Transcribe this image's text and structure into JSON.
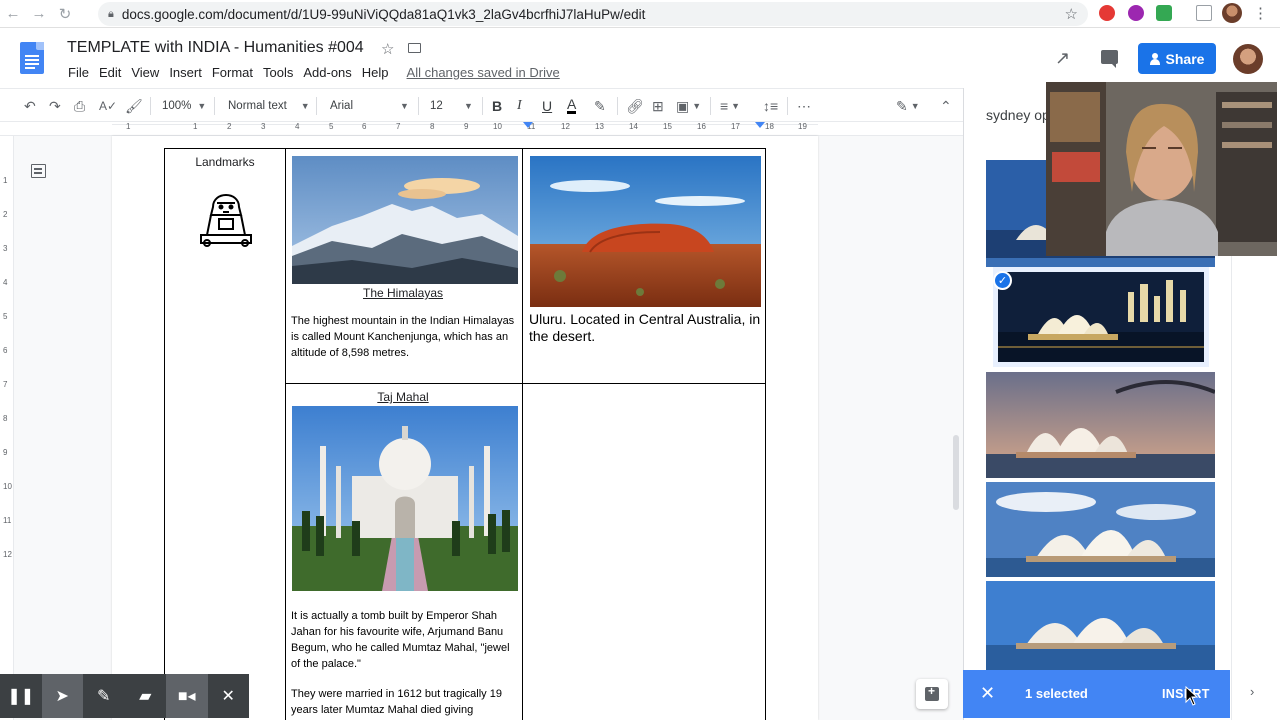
{
  "browser": {
    "url": "docs.google.com/document/d/1U9-99uNiViQQda81aQ1vk3_2laGv4bcrfhiJ7laHuPw/edit"
  },
  "doc": {
    "title": "TEMPLATE with INDIA - Humanities #004",
    "menu": [
      "File",
      "Edit",
      "View",
      "Insert",
      "Format",
      "Tools",
      "Add-ons",
      "Help"
    ],
    "save_status": "All changes saved in Drive",
    "share_label": "Share"
  },
  "toolbar": {
    "zoom": "100%",
    "style": "Normal text",
    "font": "Arial",
    "size": "12"
  },
  "ruler": {
    "numbers": [
      "1",
      "1",
      "2",
      "3",
      "4",
      "5",
      "6",
      "7",
      "8",
      "9",
      "10",
      "11",
      "12",
      "13",
      "14",
      "15",
      "16",
      "17",
      "18",
      "19"
    ]
  },
  "vruler": [
    "1",
    "2",
    "3",
    "4",
    "5",
    "6",
    "7",
    "8",
    "9",
    "10",
    "11",
    "12"
  ],
  "table": {
    "landmarks_label": "Landmarks",
    "himalayas_caption": "The Himalayas",
    "himalayas_text": "The highest mountain in the Indian Himalayas is called Mount Kanchenjunga, which has an altitude of 8,598 metres.",
    "uluru_text": "Uluru. Located in Central Australia, in the desert.",
    "taj_caption": "Taj Mahal",
    "taj_text_1": "It is actually a tomb built by Emperor Shah Jahan for his favourite wife, Arjumand Banu Begum, who he called Mumtaz Mahal, \"jewel of the palace.\"",
    "taj_text_2": "They were married in 1612 but tragically 19 years later Mumtaz Mahal died giving"
  },
  "explore": {
    "search_query": "sydney op",
    "selected_count": "1 selected",
    "insert_label": "INSERT"
  },
  "colors": {
    "accent": "#1a73e8",
    "select_bar": "#4285f4"
  }
}
